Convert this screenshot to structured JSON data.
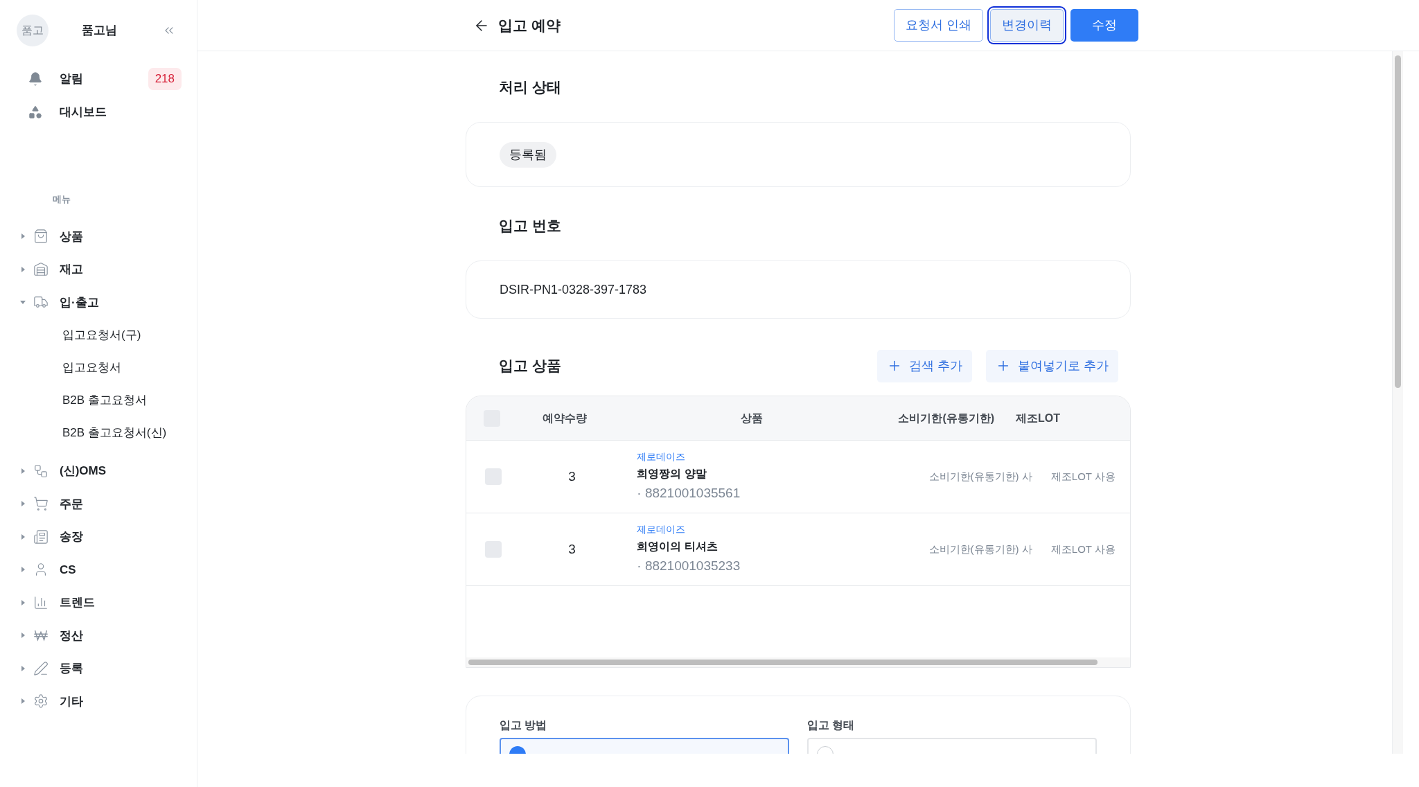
{
  "user": {
    "avatar_text": "품고",
    "name": "품고님"
  },
  "quick_links": [
    {
      "kind": "bell",
      "label": "알림",
      "badge": "218"
    },
    {
      "kind": "dashboard",
      "label": "대시보드"
    }
  ],
  "menu_heading": "메뉴",
  "menu": [
    {
      "label": "상품",
      "expanded": false
    },
    {
      "label": "재고",
      "expanded": false
    },
    {
      "label": "입·출고",
      "expanded": true,
      "children": [
        {
          "label": "입고요청서(구)"
        },
        {
          "label": "입고요청서"
        },
        {
          "label": "B2B 출고요청서"
        },
        {
          "label": "B2B 출고요청서(신)"
        }
      ]
    },
    {
      "label": "(신)OMS",
      "expanded": false
    },
    {
      "label": "주문",
      "expanded": false
    },
    {
      "label": "송장",
      "expanded": false
    },
    {
      "label": "CS",
      "expanded": false
    },
    {
      "label": "트렌드",
      "expanded": false
    },
    {
      "label": "정산",
      "expanded": false
    },
    {
      "label": "등록",
      "expanded": false
    },
    {
      "label": "기타",
      "expanded": false
    }
  ],
  "header": {
    "title": "입고 예약",
    "buttons": [
      {
        "kind": "outline",
        "label": "요청서 인쇄",
        "selected": false
      },
      {
        "kind": "outline",
        "label": "변경이력",
        "selected": true
      },
      {
        "kind": "primary",
        "label": "수정",
        "selected": false
      }
    ]
  },
  "status_section": {
    "title": "처리 상태",
    "status": "등록됨"
  },
  "number_section": {
    "title": "입고 번호",
    "value": "DSIR-PN1-0328-397-1783"
  },
  "products_section": {
    "title": "입고 상품",
    "actions": [
      "검색 추가",
      "붙여넣기로 추가"
    ],
    "table": {
      "select_all_checked": false,
      "columns": [
        "예약수량",
        "상품",
        "소비기한(유통기한)",
        "제조LOT"
      ],
      "rows": [
        {
          "checked": false,
          "quantity": "3",
          "brand": "제로데이즈",
          "name": "희영짱의 양말",
          "barcode": "· 8821001035561",
          "expiry": "소비기한(유통기한) 사",
          "lot": "제조LOT 사용"
        },
        {
          "checked": false,
          "quantity": "3",
          "brand": "제로데이즈",
          "name": "희영이의 티셔츠",
          "barcode": "· 8821001035233",
          "expiry": "소비기한(유통기한) 사",
          "lot": "제조LOT 사용"
        }
      ]
    }
  },
  "inbound_form": {
    "fields": [
      {
        "label": "입고 방법",
        "selected": true
      },
      {
        "label": "입고 형태",
        "selected": false
      }
    ]
  }
}
